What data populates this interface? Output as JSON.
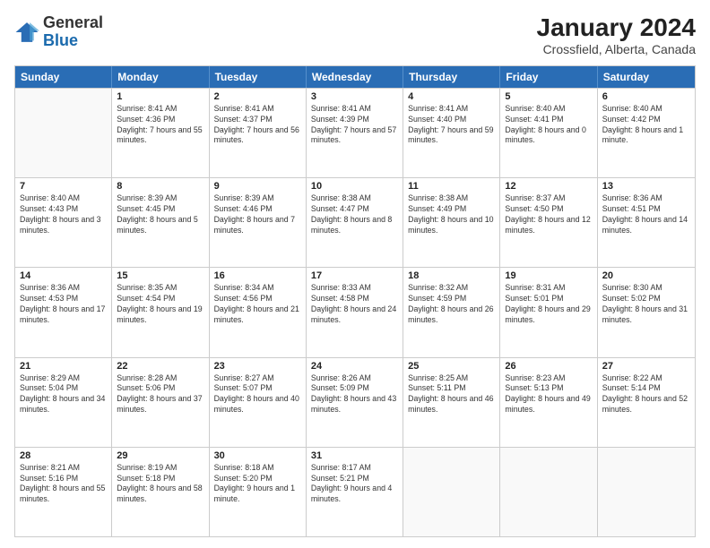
{
  "logo": {
    "general": "General",
    "blue": "Blue"
  },
  "title": "January 2024",
  "subtitle": "Crossfield, Alberta, Canada",
  "headers": [
    "Sunday",
    "Monday",
    "Tuesday",
    "Wednesday",
    "Thursday",
    "Friday",
    "Saturday"
  ],
  "weeks": [
    [
      {
        "day": "",
        "sunrise": "",
        "sunset": "",
        "daylight": "",
        "empty": true
      },
      {
        "day": "1",
        "sunrise": "Sunrise: 8:41 AM",
        "sunset": "Sunset: 4:36 PM",
        "daylight": "Daylight: 7 hours and 55 minutes."
      },
      {
        "day": "2",
        "sunrise": "Sunrise: 8:41 AM",
        "sunset": "Sunset: 4:37 PM",
        "daylight": "Daylight: 7 hours and 56 minutes."
      },
      {
        "day": "3",
        "sunrise": "Sunrise: 8:41 AM",
        "sunset": "Sunset: 4:39 PM",
        "daylight": "Daylight: 7 hours and 57 minutes."
      },
      {
        "day": "4",
        "sunrise": "Sunrise: 8:41 AM",
        "sunset": "Sunset: 4:40 PM",
        "daylight": "Daylight: 7 hours and 59 minutes."
      },
      {
        "day": "5",
        "sunrise": "Sunrise: 8:40 AM",
        "sunset": "Sunset: 4:41 PM",
        "daylight": "Daylight: 8 hours and 0 minutes."
      },
      {
        "day": "6",
        "sunrise": "Sunrise: 8:40 AM",
        "sunset": "Sunset: 4:42 PM",
        "daylight": "Daylight: 8 hours and 1 minute."
      }
    ],
    [
      {
        "day": "7",
        "sunrise": "Sunrise: 8:40 AM",
        "sunset": "Sunset: 4:43 PM",
        "daylight": "Daylight: 8 hours and 3 minutes."
      },
      {
        "day": "8",
        "sunrise": "Sunrise: 8:39 AM",
        "sunset": "Sunset: 4:45 PM",
        "daylight": "Daylight: 8 hours and 5 minutes."
      },
      {
        "day": "9",
        "sunrise": "Sunrise: 8:39 AM",
        "sunset": "Sunset: 4:46 PM",
        "daylight": "Daylight: 8 hours and 7 minutes."
      },
      {
        "day": "10",
        "sunrise": "Sunrise: 8:38 AM",
        "sunset": "Sunset: 4:47 PM",
        "daylight": "Daylight: 8 hours and 8 minutes."
      },
      {
        "day": "11",
        "sunrise": "Sunrise: 8:38 AM",
        "sunset": "Sunset: 4:49 PM",
        "daylight": "Daylight: 8 hours and 10 minutes."
      },
      {
        "day": "12",
        "sunrise": "Sunrise: 8:37 AM",
        "sunset": "Sunset: 4:50 PM",
        "daylight": "Daylight: 8 hours and 12 minutes."
      },
      {
        "day": "13",
        "sunrise": "Sunrise: 8:36 AM",
        "sunset": "Sunset: 4:51 PM",
        "daylight": "Daylight: 8 hours and 14 minutes."
      }
    ],
    [
      {
        "day": "14",
        "sunrise": "Sunrise: 8:36 AM",
        "sunset": "Sunset: 4:53 PM",
        "daylight": "Daylight: 8 hours and 17 minutes."
      },
      {
        "day": "15",
        "sunrise": "Sunrise: 8:35 AM",
        "sunset": "Sunset: 4:54 PM",
        "daylight": "Daylight: 8 hours and 19 minutes."
      },
      {
        "day": "16",
        "sunrise": "Sunrise: 8:34 AM",
        "sunset": "Sunset: 4:56 PM",
        "daylight": "Daylight: 8 hours and 21 minutes."
      },
      {
        "day": "17",
        "sunrise": "Sunrise: 8:33 AM",
        "sunset": "Sunset: 4:58 PM",
        "daylight": "Daylight: 8 hours and 24 minutes."
      },
      {
        "day": "18",
        "sunrise": "Sunrise: 8:32 AM",
        "sunset": "Sunset: 4:59 PM",
        "daylight": "Daylight: 8 hours and 26 minutes."
      },
      {
        "day": "19",
        "sunrise": "Sunrise: 8:31 AM",
        "sunset": "Sunset: 5:01 PM",
        "daylight": "Daylight: 8 hours and 29 minutes."
      },
      {
        "day": "20",
        "sunrise": "Sunrise: 8:30 AM",
        "sunset": "Sunset: 5:02 PM",
        "daylight": "Daylight: 8 hours and 31 minutes."
      }
    ],
    [
      {
        "day": "21",
        "sunrise": "Sunrise: 8:29 AM",
        "sunset": "Sunset: 5:04 PM",
        "daylight": "Daylight: 8 hours and 34 minutes."
      },
      {
        "day": "22",
        "sunrise": "Sunrise: 8:28 AM",
        "sunset": "Sunset: 5:06 PM",
        "daylight": "Daylight: 8 hours and 37 minutes."
      },
      {
        "day": "23",
        "sunrise": "Sunrise: 8:27 AM",
        "sunset": "Sunset: 5:07 PM",
        "daylight": "Daylight: 8 hours and 40 minutes."
      },
      {
        "day": "24",
        "sunrise": "Sunrise: 8:26 AM",
        "sunset": "Sunset: 5:09 PM",
        "daylight": "Daylight: 8 hours and 43 minutes."
      },
      {
        "day": "25",
        "sunrise": "Sunrise: 8:25 AM",
        "sunset": "Sunset: 5:11 PM",
        "daylight": "Daylight: 8 hours and 46 minutes."
      },
      {
        "day": "26",
        "sunrise": "Sunrise: 8:23 AM",
        "sunset": "Sunset: 5:13 PM",
        "daylight": "Daylight: 8 hours and 49 minutes."
      },
      {
        "day": "27",
        "sunrise": "Sunrise: 8:22 AM",
        "sunset": "Sunset: 5:14 PM",
        "daylight": "Daylight: 8 hours and 52 minutes."
      }
    ],
    [
      {
        "day": "28",
        "sunrise": "Sunrise: 8:21 AM",
        "sunset": "Sunset: 5:16 PM",
        "daylight": "Daylight: 8 hours and 55 minutes."
      },
      {
        "day": "29",
        "sunrise": "Sunrise: 8:19 AM",
        "sunset": "Sunset: 5:18 PM",
        "daylight": "Daylight: 8 hours and 58 minutes."
      },
      {
        "day": "30",
        "sunrise": "Sunrise: 8:18 AM",
        "sunset": "Sunset: 5:20 PM",
        "daylight": "Daylight: 9 hours and 1 minute."
      },
      {
        "day": "31",
        "sunrise": "Sunrise: 8:17 AM",
        "sunset": "Sunset: 5:21 PM",
        "daylight": "Daylight: 9 hours and 4 minutes."
      },
      {
        "day": "",
        "sunrise": "",
        "sunset": "",
        "daylight": "",
        "empty": true
      },
      {
        "day": "",
        "sunrise": "",
        "sunset": "",
        "daylight": "",
        "empty": true
      },
      {
        "day": "",
        "sunrise": "",
        "sunset": "",
        "daylight": "",
        "empty": true
      }
    ]
  ]
}
